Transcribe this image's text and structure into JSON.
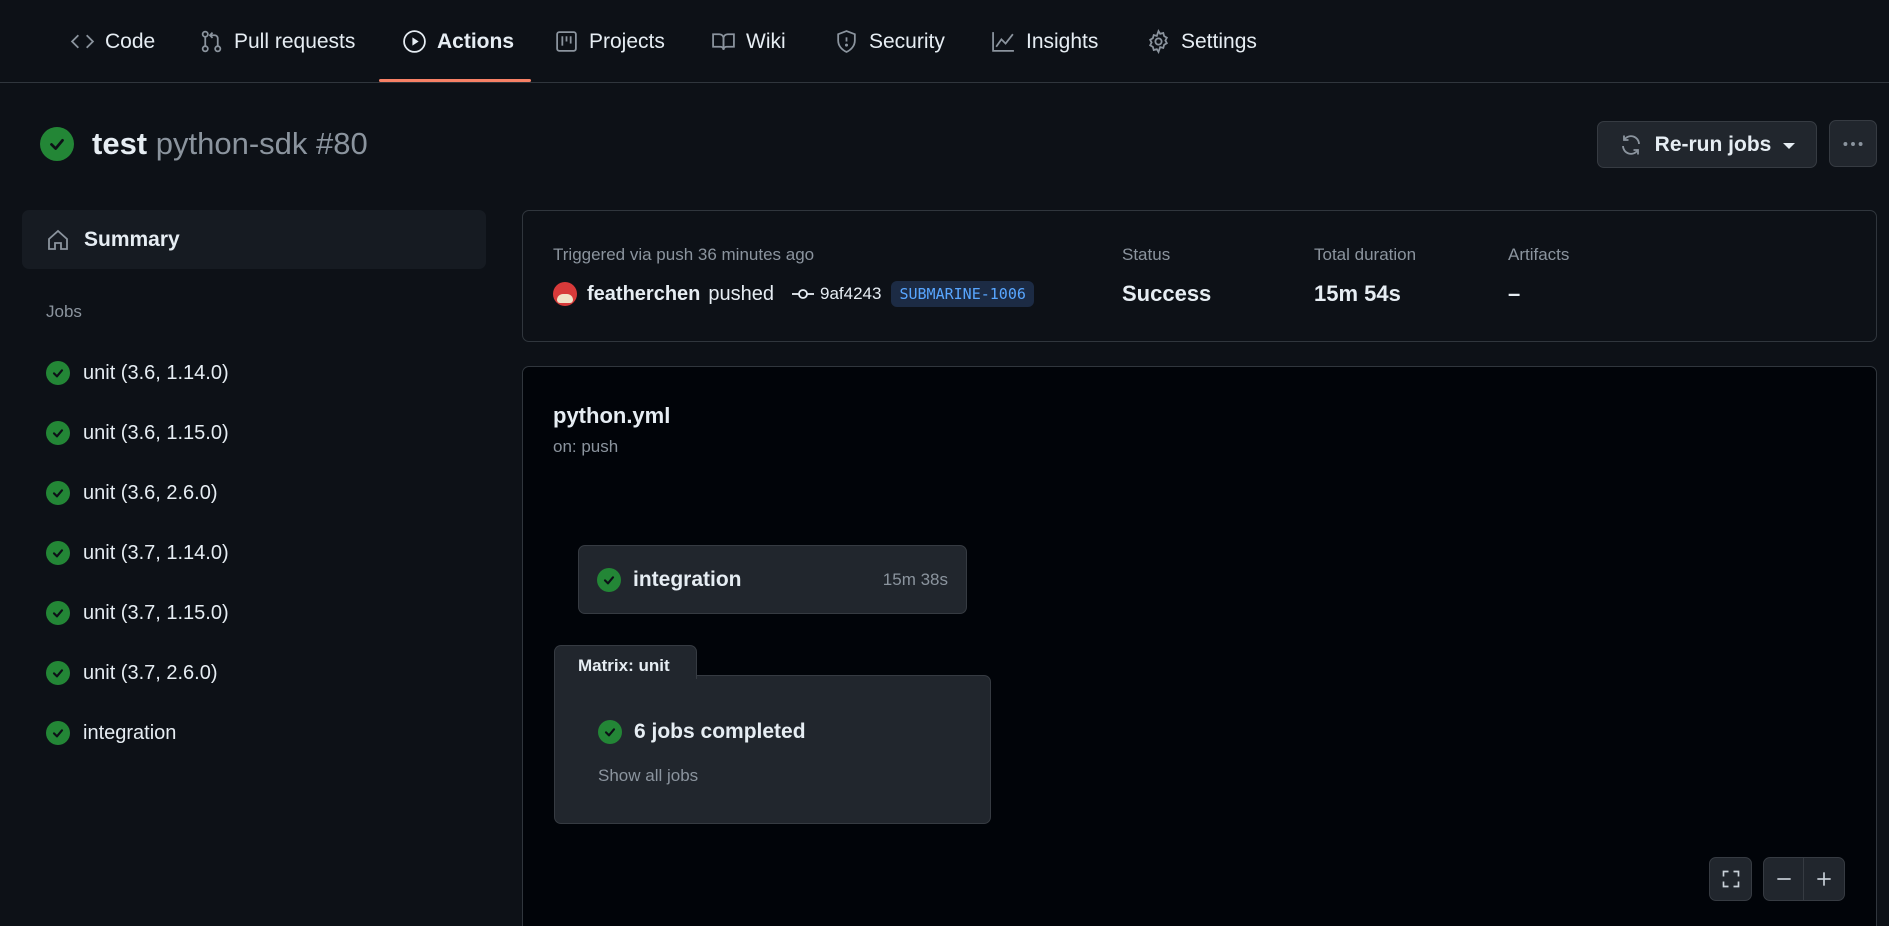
{
  "nav": {
    "tabs": [
      {
        "label": "Code",
        "icon": "code-icon"
      },
      {
        "label": "Pull requests",
        "icon": "git-pull-request-icon"
      },
      {
        "label": "Actions",
        "icon": "play-icon",
        "active": true
      },
      {
        "label": "Projects",
        "icon": "project-icon"
      },
      {
        "label": "Wiki",
        "icon": "book-icon"
      },
      {
        "label": "Security",
        "icon": "shield-icon"
      },
      {
        "label": "Insights",
        "icon": "graph-icon"
      },
      {
        "label": "Settings",
        "icon": "gear-icon"
      }
    ],
    "active_underline_color": "#f78166"
  },
  "run": {
    "workflow": "test",
    "title_suffix": "python-sdk #80",
    "status_color": "#238636"
  },
  "actions": {
    "rerun_label": "Re-run jobs"
  },
  "sidebar": {
    "summary_label": "Summary",
    "jobs_label": "Jobs",
    "jobs": [
      "unit (3.6, 1.14.0)",
      "unit (3.6, 1.15.0)",
      "unit (3.6, 2.6.0)",
      "unit (3.7, 1.14.0)",
      "unit (3.7, 1.15.0)",
      "unit (3.7, 2.6.0)",
      "integration"
    ]
  },
  "summary_card": {
    "triggered": "Triggered via push 36 minutes ago",
    "user": "featherchen",
    "action": "pushed",
    "commit": "9af4243",
    "branch": "SUBMARINE-1006",
    "status_label": "Status",
    "status_value": "Success",
    "duration_label": "Total duration",
    "duration_value": "15m 54s",
    "artifacts_label": "Artifacts",
    "artifacts_value": "–"
  },
  "graph": {
    "workflow_file": "python.yml",
    "trigger": "on: push",
    "job": {
      "name": "integration",
      "duration": "15m 38s"
    },
    "matrix": {
      "tab_label": "Matrix: unit",
      "completed": "6 jobs completed",
      "show_all": "Show all jobs"
    }
  }
}
